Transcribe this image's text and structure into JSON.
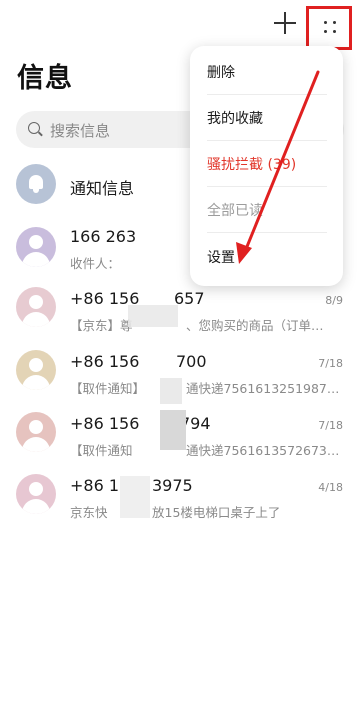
{
  "toolbar": {
    "add_icon": "plus-icon",
    "more_icon": "more-dots-icon",
    "highlight_color": "#e02020"
  },
  "page": {
    "title": "信息"
  },
  "search": {
    "placeholder": "搜索信息"
  },
  "conversations": [
    {
      "name": "通知信息",
      "preview": "",
      "date": "",
      "avatar_color": "#b7c3d6",
      "icon": "bell-icon"
    },
    {
      "name": "166 263",
      "preview": "收件人：",
      "date": "",
      "avatar_color": "#c9bddd",
      "icon": "person-icon"
    },
    {
      "name": "+86 156",
      "name_tail": "657",
      "preview": "【京东】尊",
      "preview_tail": "、您购买的商品（订单…",
      "date": "8/9",
      "avatar_color": "#e7cbd1",
      "icon": "person-icon"
    },
    {
      "name": "+86 156",
      "name_tail": "700",
      "preview": "【取件通知】",
      "preview_tail": "通快递7561613251987…",
      "date": "7/18",
      "avatar_color": "#e3d4b6",
      "icon": "person-icon"
    },
    {
      "name": "+86 156",
      "name_tail": "794",
      "preview": "【取件通知",
      "preview_tail": "通快递7561613572673…",
      "date": "7/18",
      "avatar_color": "#e6c3bf",
      "icon": "person-icon"
    },
    {
      "name": "+86 1",
      "name_tail": "3975",
      "preview": "京东快",
      "preview_tail": "放15楼电梯口桌子上了",
      "date": "4/18",
      "avatar_color": "#e7c7d2",
      "icon": "person-icon"
    }
  ],
  "menu": {
    "items": [
      {
        "label": "删除",
        "style": "normal"
      },
      {
        "label": "我的收藏",
        "style": "normal"
      },
      {
        "label": "骚扰拦截 (39)",
        "style": "danger"
      },
      {
        "label": "全部已读",
        "style": "disabled"
      },
      {
        "label": "设置",
        "style": "normal"
      }
    ]
  },
  "annotation": {
    "arrow_color": "#e02020"
  }
}
